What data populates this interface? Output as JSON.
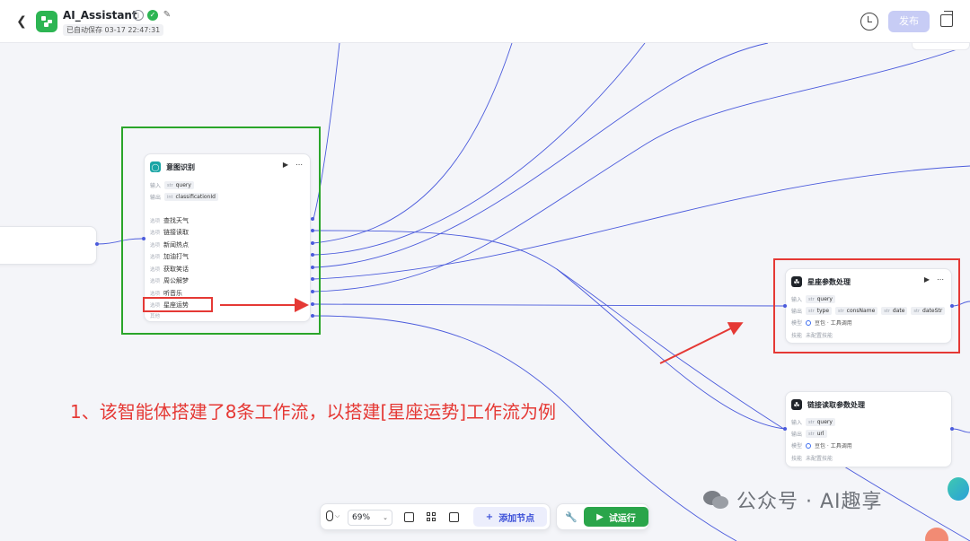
{
  "header": {
    "app_title": "AI_Assistant",
    "autosave": "已自动保存 03-17 22:47:31",
    "publish_label": "发布"
  },
  "intent_node": {
    "title": "意图识别",
    "input_label": "输入",
    "input_type": "str",
    "input_value": "query",
    "output_label": "输出",
    "output_type": "int",
    "output_value": "classificationId",
    "option_tag": "选项",
    "options": [
      "查找天气",
      "链接读取",
      "新闻热点",
      "加油打气",
      "获取笑话",
      "周公解梦",
      "听音乐",
      "星座运势"
    ],
    "other_label": "其他"
  },
  "zodiac_node": {
    "title": "星座参数处理",
    "input_label": "输入",
    "input_type": "str",
    "input_value": "query",
    "output_label": "输出",
    "outputs": [
      {
        "type": "str",
        "name": "type"
      },
      {
        "type": "str",
        "name": "consName"
      },
      {
        "type": "str",
        "name": "date"
      },
      {
        "type": "str",
        "name": "dateStr"
      }
    ],
    "model_label": "模型",
    "model_value": "豆包 · 工具调用",
    "skill_label": "技能",
    "skill_value": "未配置技能"
  },
  "link_node": {
    "title": "链接读取参数处理",
    "input_label": "输入",
    "input_type": "str",
    "input_value": "query",
    "output_label": "输出",
    "output_type": "str",
    "output_value": "url",
    "model_label": "模型",
    "model_value": "豆包 · 工具调用",
    "skill_label": "技能",
    "skill_value": "未配置技能"
  },
  "annotation": {
    "text": "1、该智能体搭建了8条工作流，以搭建[星座运势]工作流为例"
  },
  "toolbar": {
    "zoom": "69%",
    "add_node_label": "添加节点",
    "run_label": "试运行"
  },
  "watermark": {
    "text": "公众号 · AI趣享"
  },
  "colors": {
    "edge": "#4b5bdc",
    "highlight_green": "#2aa52a",
    "highlight_red": "#e53935",
    "accent": "#3b4fd8",
    "run_green": "#2aa54a"
  }
}
